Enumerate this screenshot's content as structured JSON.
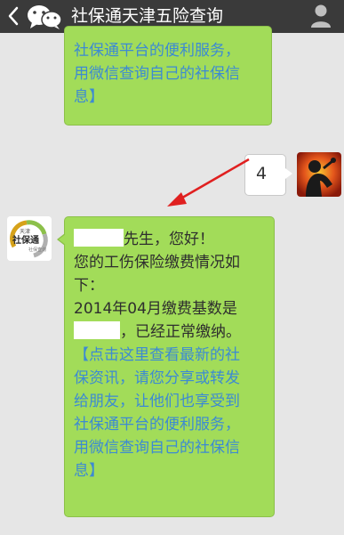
{
  "header": {
    "title": "社保通天津五险查询",
    "back_icon": "chevron-left-icon",
    "logo_icon": "wechat-icon",
    "profile_icon": "person-icon"
  },
  "messages": {
    "m1": {
      "lines": [
        "社保通平台的便利服务，",
        "用微信查询自己的社保信",
        "息】"
      ]
    },
    "m2": {
      "text": "4"
    },
    "m3": {
      "greeting_suffix": "先生，您好！",
      "body_lines": [
        "您的工伤保险缴费情况如",
        "下：",
        "2014年04月缴费基数是"
      ],
      "status_suffix": "，已经正常缴纳。",
      "link_lines": [
        "【点击这里查看最新的社",
        "保资讯，请您分享或转发",
        "给朋友，让他们也享受到",
        "社保通平台的便利服务，",
        "用微信查询自己的社保信",
        "息】"
      ]
    }
  },
  "official_avatar": {
    "text_top": "天津",
    "text_main": "社保通",
    "text_bottom": "社保查询"
  },
  "colors": {
    "topbar": "#3a3a3a",
    "chat_bg": "#e6e6e6",
    "bubble_green": "#a2dc59",
    "link": "#3c8ad3",
    "annotation_arrow": "#e02020"
  }
}
